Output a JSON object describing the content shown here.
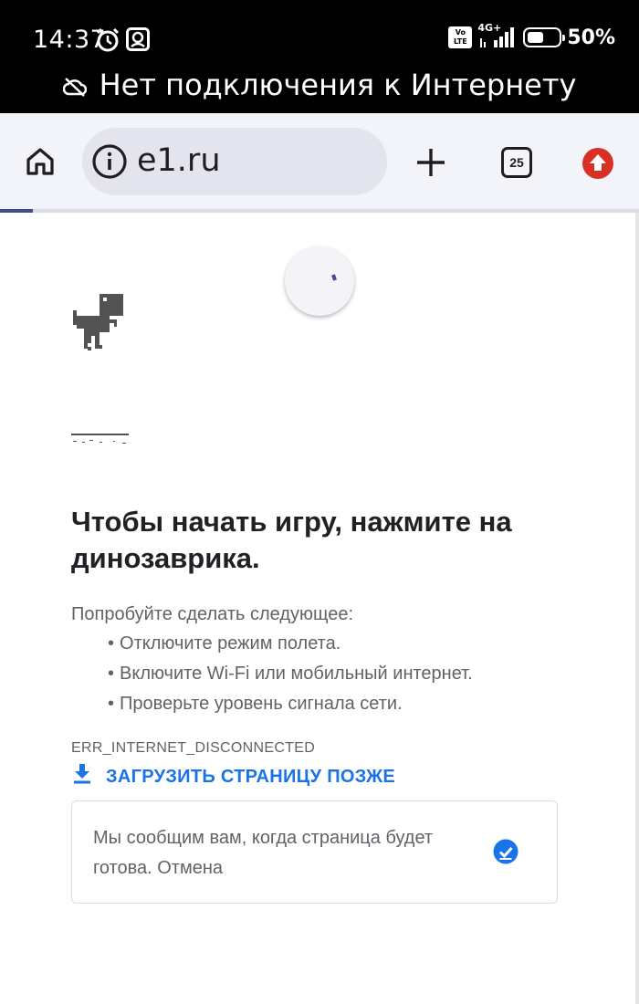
{
  "status_bar": {
    "time": "14:37",
    "volte_label": "Vo LTE",
    "network_label": "4G+",
    "battery_percent": "50%",
    "battery_level": 0.5,
    "icons": [
      "alarm-icon",
      "app-notification-icon",
      "volte-icon",
      "signal-icon",
      "battery-icon"
    ]
  },
  "offline_banner": {
    "text": "Нет подключения к Интернету",
    "icon": "cloud-off-icon"
  },
  "toolbar": {
    "url": "e1.ru",
    "tab_count": "25",
    "icons": [
      "home-icon",
      "info-icon",
      "plus-icon",
      "tab-switcher-icon",
      "update-arrow-icon"
    ],
    "accent_color": "#d93025"
  },
  "page": {
    "title": "Чтобы начать игру, нажмите на динозаврика.",
    "suggestions_heading": "Попробуйте сделать следующее:",
    "suggestions": [
      "Отключите режим полета.",
      "Включите Wi-Fi или мобильный интернет.",
      "Проверьте уровень сигнала сети."
    ],
    "error_code": "ERR_INTERNET_DISCONNECTED",
    "download_label": "ЗАГРУЗИТЬ СТРАНИЦУ ПОЗЖЕ",
    "notice_text": "Мы сообщим вам, когда страница будет готова. Отмена",
    "link_color": "#1a73e8"
  }
}
